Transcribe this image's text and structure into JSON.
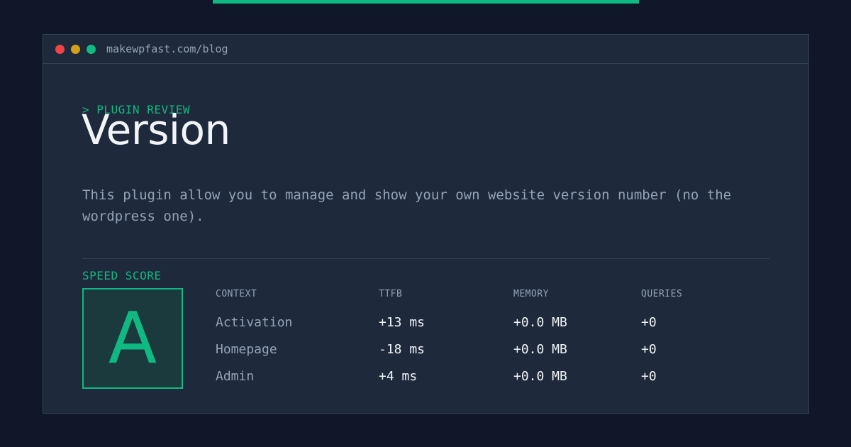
{
  "window": {
    "url": "makewpfast.com/blog",
    "dots": [
      {
        "name": "close",
        "color": "#ef4444"
      },
      {
        "name": "minimize",
        "color": "#d4a017"
      },
      {
        "name": "maximize",
        "color": "#10b981"
      }
    ]
  },
  "eyebrow": "> PLUGIN REVIEW",
  "title": "Version",
  "description": "This plugin allow you to manage and show your own website version number (no the wordpress one).",
  "speed": {
    "label": "SPEED SCORE",
    "grade": "A"
  },
  "metrics": {
    "headers": [
      "CONTEXT",
      "TTFB",
      "MEMORY",
      "QUERIES"
    ],
    "rows": [
      {
        "context": "Activation",
        "ttfb": "+13 ms",
        "memory": "+0.0 MB",
        "queries": "+0"
      },
      {
        "context": "Homepage",
        "ttfb": "-18 ms",
        "memory": "+0.0 MB",
        "queries": "+0"
      },
      {
        "context": "Admin",
        "ttfb": "+4 ms",
        "memory": "+0.0 MB",
        "queries": "+0"
      }
    ]
  },
  "colors": {
    "accent": "#10b981",
    "background": "#0f1729",
    "panel": "#1e293b"
  }
}
